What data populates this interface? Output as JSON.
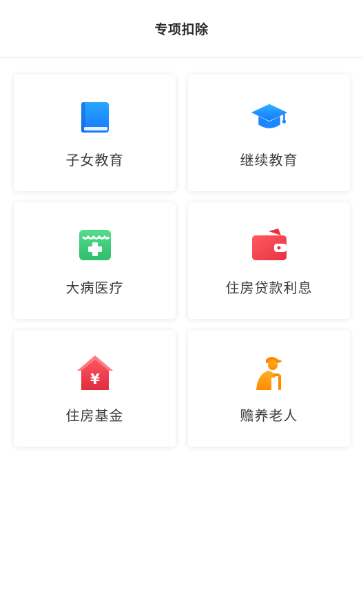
{
  "header": {
    "title": "专项扣除"
  },
  "items": [
    {
      "label": "子女教育",
      "icon": "book-icon",
      "color": "#1e90ff"
    },
    {
      "label": "继续教育",
      "icon": "graduation-cap-icon",
      "color": "#1e90ff"
    },
    {
      "label": "大病医疗",
      "icon": "medical-box-icon",
      "color": "#3ccf7a"
    },
    {
      "label": "住房贷款利息",
      "icon": "wallet-icon",
      "color": "#f04652"
    },
    {
      "label": "住房基金",
      "icon": "house-yuan-icon",
      "color": "#f04652"
    },
    {
      "label": "赡养老人",
      "icon": "elderly-person-icon",
      "color": "#ff9a1f"
    }
  ]
}
